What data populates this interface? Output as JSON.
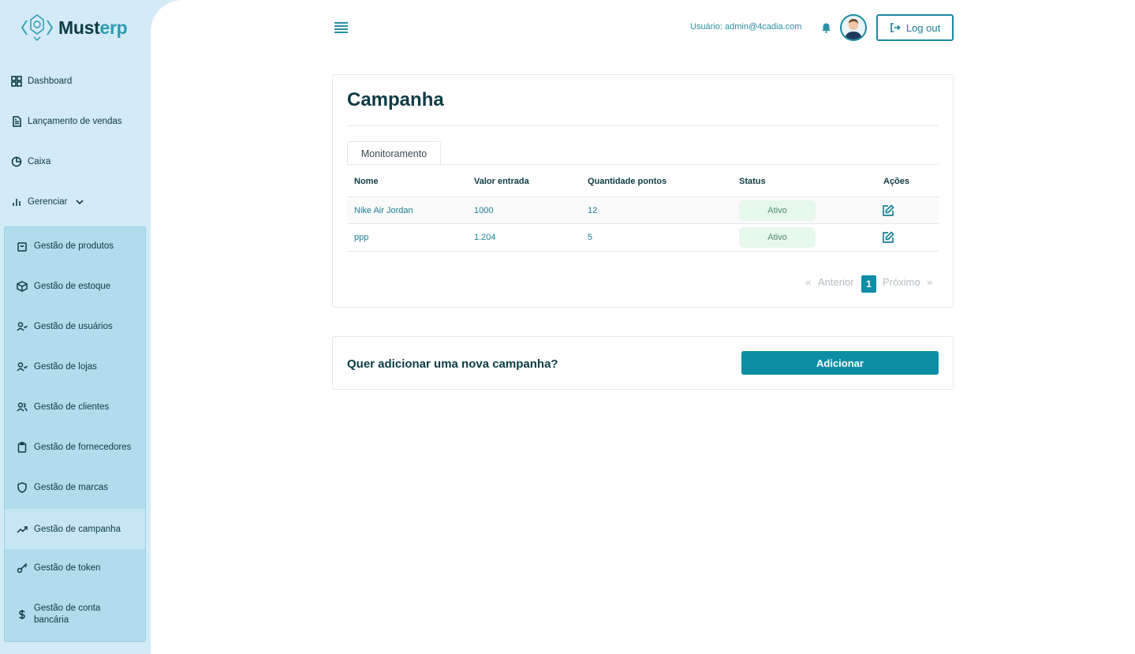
{
  "app": {
    "name_main": "Must",
    "name_accent": "erp",
    "brand_color": "#0c8ea6"
  },
  "sidebar": {
    "items": [
      {
        "label": "Dashboard",
        "icon": "grid-icon"
      },
      {
        "label": "Lançamento de vendas",
        "icon": "document-icon"
      },
      {
        "label": "Caixa",
        "icon": "pie-chart-icon"
      },
      {
        "label": "Gerenciar",
        "icon": "bar-chart-icon",
        "expanded": true
      }
    ],
    "submenu": [
      {
        "label": "Gestão de produtos",
        "icon": "shopping-bag-icon"
      },
      {
        "label": "Gestão de estoque",
        "icon": "box-icon"
      },
      {
        "label": "Gestão de usuários",
        "icon": "user-check-icon"
      },
      {
        "label": "Gestão de lojas",
        "icon": "user-check-icon"
      },
      {
        "label": "Gestão de clientes",
        "icon": "users-icon"
      },
      {
        "label": "Gestão de fornecedores",
        "icon": "clipboard-icon"
      },
      {
        "label": "Gestão de marcas",
        "icon": "shield-icon"
      },
      {
        "label": "Gestão de campanha",
        "icon": "trending-up-icon",
        "active": true
      },
      {
        "label": "Gestão de token",
        "icon": "key-icon"
      },
      {
        "label": "Gestão de conta bancária",
        "icon": "dollar-icon"
      }
    ]
  },
  "header": {
    "user_label": "Usuário: admin@4cadia.com",
    "logout_label": "Log out"
  },
  "main": {
    "title": "Campanha",
    "tab": "Monitoramento",
    "table": {
      "columns": [
        "Nome",
        "Valor entrada",
        "Quantidade pontos",
        "Status",
        "Ações"
      ],
      "rows": [
        {
          "nome": "Nike Air Jordan",
          "valor": "1000",
          "pontos": "12",
          "status": "Ativo"
        },
        {
          "nome": "ppp",
          "valor": "1.204",
          "pontos": "5",
          "status": "Ativo"
        }
      ]
    },
    "pagination": {
      "prev_symbol": "«",
      "prev_label": "Anterior",
      "current": "1",
      "next_label": "Próximo",
      "next_symbol": "»"
    }
  },
  "add_section": {
    "question": "Quer adicionar uma nova campanha?",
    "button_label": "Adicionar"
  }
}
